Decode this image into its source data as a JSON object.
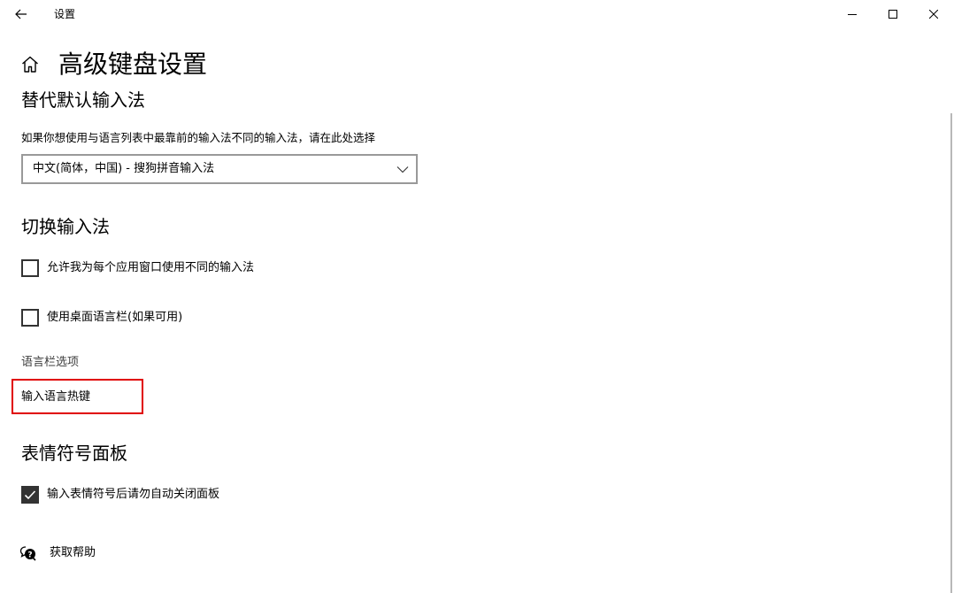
{
  "window": {
    "title": "设置"
  },
  "icons": {
    "back": "back-arrow-icon",
    "minimize": "minimize-icon",
    "maximize": "maximize-icon",
    "close": "close-icon",
    "home": "home-icon",
    "chevron": "chevron-down-icon",
    "check": "checkmark-icon",
    "help": "help-chat-icon"
  },
  "page": {
    "title": "高级键盘设置"
  },
  "default_input": {
    "heading": "替代默认输入法",
    "description": "如果你想使用与语言列表中最靠前的输入法不同的输入法，请在此处选择",
    "selected": "中文(简体，中国) - 搜狗拼音输入法"
  },
  "switch_input": {
    "heading": "切换输入法",
    "option_per_app": {
      "label": "允许我为每个应用窗口使用不同的输入法",
      "checked": false
    },
    "option_language_bar": {
      "label": "使用桌面语言栏(如果可用)",
      "checked": false
    },
    "language_bar_options_link": "语言栏选项",
    "input_hotkeys_link": "输入语言热键"
  },
  "emoji_panel": {
    "heading": "表情符号面板",
    "option_auto_close": {
      "label": "输入表情符号后请勿自动关闭面板",
      "checked": true
    }
  },
  "help": {
    "label": "获取帮助"
  },
  "colors": {
    "highlight": "#e00000",
    "checkbox_border": "#333333",
    "dropdown_border": "#999999"
  }
}
